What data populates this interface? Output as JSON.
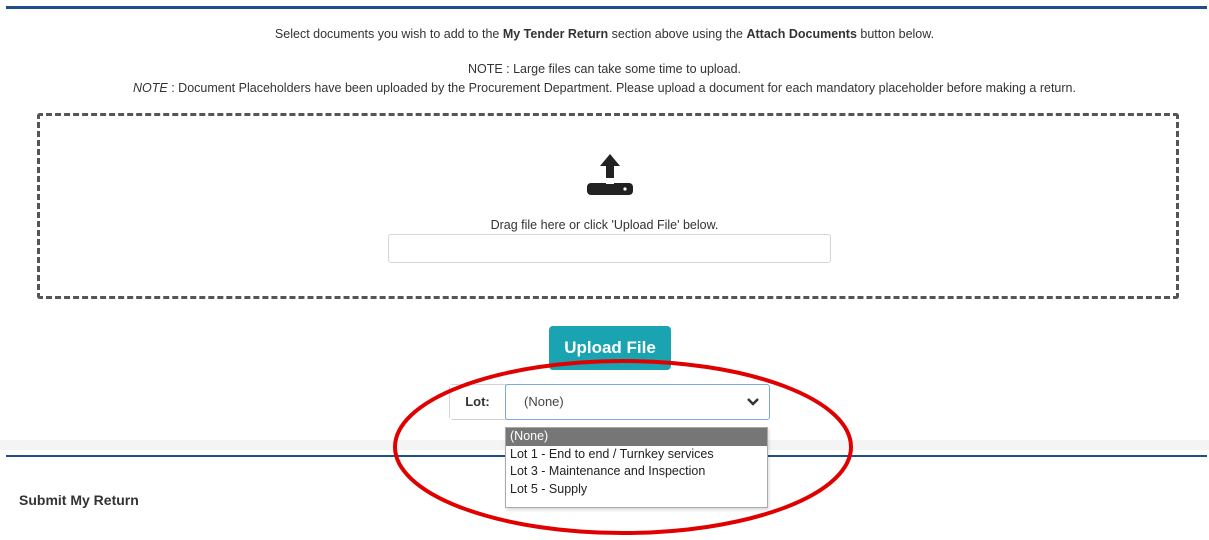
{
  "instructions": {
    "line1_pre": "Select documents you wish to add to the ",
    "line1_b1": "My Tender Return",
    "line1_mid": " section above using the ",
    "line1_b2": "Attach Documents",
    "line1_post": " button below.",
    "note1": "NOTE : Large files can take some time to upload.",
    "note2_label": "NOTE",
    "note2_text": " : Document Placeholders have been uploaded by the Procurement Department. Please upload a document for each mandatory placeholder before making a return."
  },
  "dropzone": {
    "icon": "upload-icon",
    "drag_text": "Drag file here or click 'Upload File' below.",
    "file_value": ""
  },
  "upload_button": {
    "label": "Upload File",
    "color": "#1aa3b0"
  },
  "lot": {
    "label": "Lot:",
    "selected": "(None)",
    "options": [
      "(None)",
      "Lot 1 - End to end / Turnkey services",
      "Lot 3 - Maintenance and Inspection",
      "Lot 5 - Supply"
    ]
  },
  "submit": {
    "title": "Submit My Return"
  },
  "colors": {
    "accent_rule": "#1f4e8c",
    "annotation": "#e00000"
  }
}
